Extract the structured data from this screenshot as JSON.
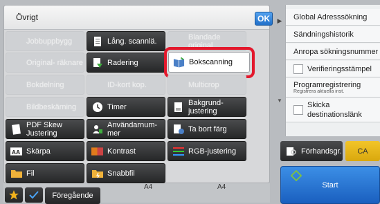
{
  "panel": {
    "title": "Övrigt",
    "ok_label": "OK"
  },
  "grid": [
    {
      "label": "Jobbuppbygg",
      "enabled": false,
      "icon": "job-build-icon"
    },
    {
      "label": "Lång. scannlä.",
      "enabled": true,
      "icon": "long-scan-icon"
    },
    {
      "label": "Blandade original",
      "enabled": false,
      "icon": "mixed-originals-icon"
    },
    {
      "label": "Original- räknare",
      "enabled": false,
      "icon": "original-counter-icon"
    },
    {
      "label": "Radering",
      "enabled": true,
      "icon": "erase-icon"
    },
    {
      "label": "Bokscanning",
      "enabled": true,
      "selected": true,
      "icon": "book-scan-icon"
    },
    {
      "label": "Bokdelning",
      "enabled": false,
      "icon": "book-split-icon"
    },
    {
      "label": "ID-kort kop.",
      "enabled": false,
      "icon": "id-card-icon"
    },
    {
      "label": "Multicrop",
      "enabled": false,
      "icon": "multicrop-icon"
    },
    {
      "label": "Bildbeskärning",
      "enabled": false,
      "icon": "image-crop-icon"
    },
    {
      "label": "Timer",
      "enabled": true,
      "icon": "timer-icon"
    },
    {
      "label": "Bakgrund- justering",
      "enabled": true,
      "icon": "background-adjust-icon"
    },
    {
      "label": "PDF Skew Justering",
      "enabled": true,
      "icon": "pdf-skew-icon"
    },
    {
      "label": "Användarnum- mer",
      "enabled": true,
      "icon": "user-number-icon"
    },
    {
      "label": "Ta bort färg",
      "enabled": true,
      "icon": "remove-color-icon"
    },
    {
      "label": "Skärpa",
      "enabled": true,
      "icon": "sharpness-icon"
    },
    {
      "label": "Kontrast",
      "enabled": true,
      "icon": "contrast-icon"
    },
    {
      "label": "RGB-justering",
      "enabled": true,
      "icon": "rgb-adjust-icon"
    },
    {
      "label": "Fil",
      "enabled": true,
      "icon": "folder-icon"
    },
    {
      "label": "Snabbfil",
      "enabled": true,
      "icon": "quick-file-icon"
    }
  ],
  "bottom": {
    "prev_label": "Föregående",
    "paper_1": "A4",
    "paper_2": "A4"
  },
  "right_menu": [
    {
      "label": "Global Adresssökning",
      "checkbox": false
    },
    {
      "label": "Sändningshistorik",
      "checkbox": false
    },
    {
      "label": "Anropa sökningsnummer",
      "checkbox": false
    },
    {
      "label": "Verifieringsstämpel",
      "checkbox": true
    },
    {
      "label": "Programregistrering",
      "sublabel": "Registrera aktuella inst.",
      "checkbox": false
    },
    {
      "label": "Skicka destinationslänk",
      "checkbox": true
    }
  ],
  "actions": {
    "preview_label": "Förhandsgr.",
    "ca_label": "CA",
    "start_label": "Start"
  },
  "colors": {
    "accent_blue": "#1f6fc8",
    "selection_red": "#e3182c",
    "ca_yellow": "#e6b51b"
  }
}
